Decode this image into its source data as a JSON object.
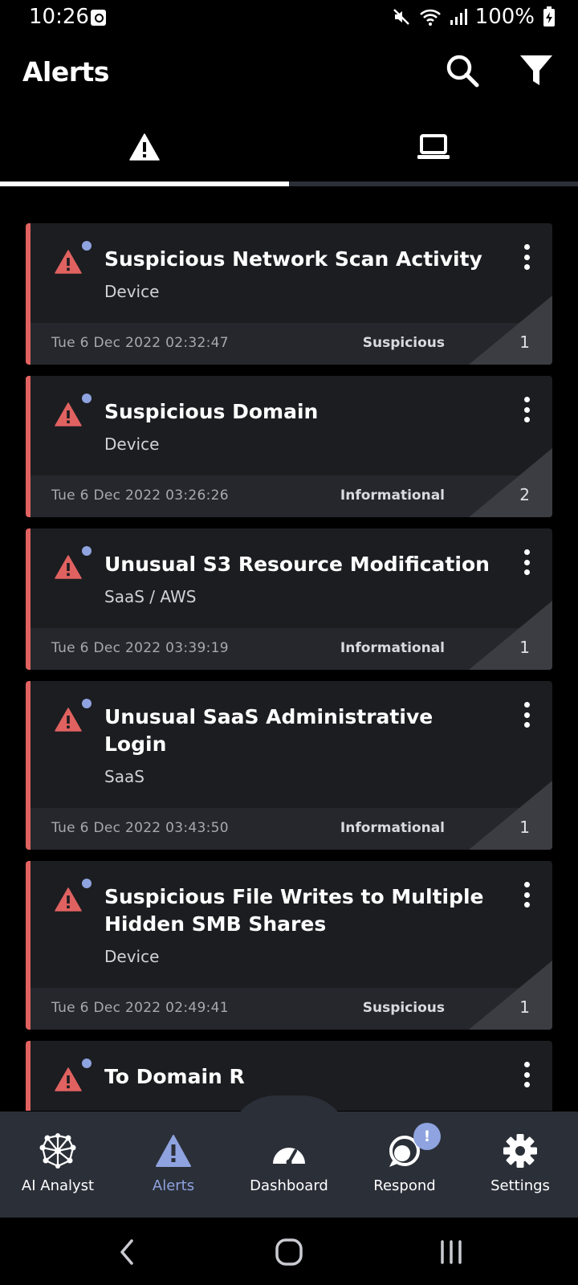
{
  "status_bar": {
    "time": "10:26",
    "battery": "100%",
    "icons": [
      "mute-icon",
      "wifi-icon",
      "signal-icon",
      "battery-charging-icon"
    ]
  },
  "header": {
    "title": "Alerts",
    "search_icon": "search-icon",
    "filter_icon": "filter-icon"
  },
  "tabs": [
    {
      "icon": "warning-icon",
      "active": true
    },
    {
      "icon": "laptop-icon",
      "active": false
    }
  ],
  "alerts": [
    {
      "title": "Suspicious Network Scan Activity",
      "source": "Device",
      "time": "Tue 6 Dec 2022 02:32:47",
      "category": "Suspicious",
      "score": "1"
    },
    {
      "title": "Suspicious Domain",
      "source": "Device",
      "time": "Tue 6 Dec 2022 03:26:26",
      "category": "Informational",
      "score": "2"
    },
    {
      "title": "Unusual S3 Resource Modification",
      "source": "SaaS / AWS",
      "time": "Tue 6 Dec 2022 03:39:19",
      "category": "Informational",
      "score": "1"
    },
    {
      "title": "Unusual SaaS Administrative Login",
      "source": "SaaS",
      "time": "Tue 6 Dec 2022 03:43:50",
      "category": "Informational",
      "score": "1"
    },
    {
      "title": "Suspicious File Writes to Multiple Hidden SMB Shares",
      "source": "Device",
      "time": "Tue 6 Dec 2022 02:49:41",
      "category": "Suspicious",
      "score": "1"
    },
    {
      "title": "To Domain R",
      "source": "",
      "time": "",
      "category": "",
      "score": ""
    }
  ],
  "bottom_nav": [
    {
      "label": "AI Analyst",
      "icon": "network-icon",
      "active": false
    },
    {
      "label": "Alerts",
      "icon": "alert-icon",
      "active": true
    },
    {
      "label": "Dashboard",
      "icon": "gauge-icon",
      "active": false
    },
    {
      "label": "Respond",
      "icon": "respond-icon",
      "active": false,
      "badge": "!"
    },
    {
      "label": "Settings",
      "icon": "gear-icon",
      "active": false
    }
  ],
  "colors": {
    "accent": "#8ea3df",
    "alert_red": "#e06260",
    "card_bg": "#1c1d21",
    "nav_bg": "#2b2f38"
  }
}
